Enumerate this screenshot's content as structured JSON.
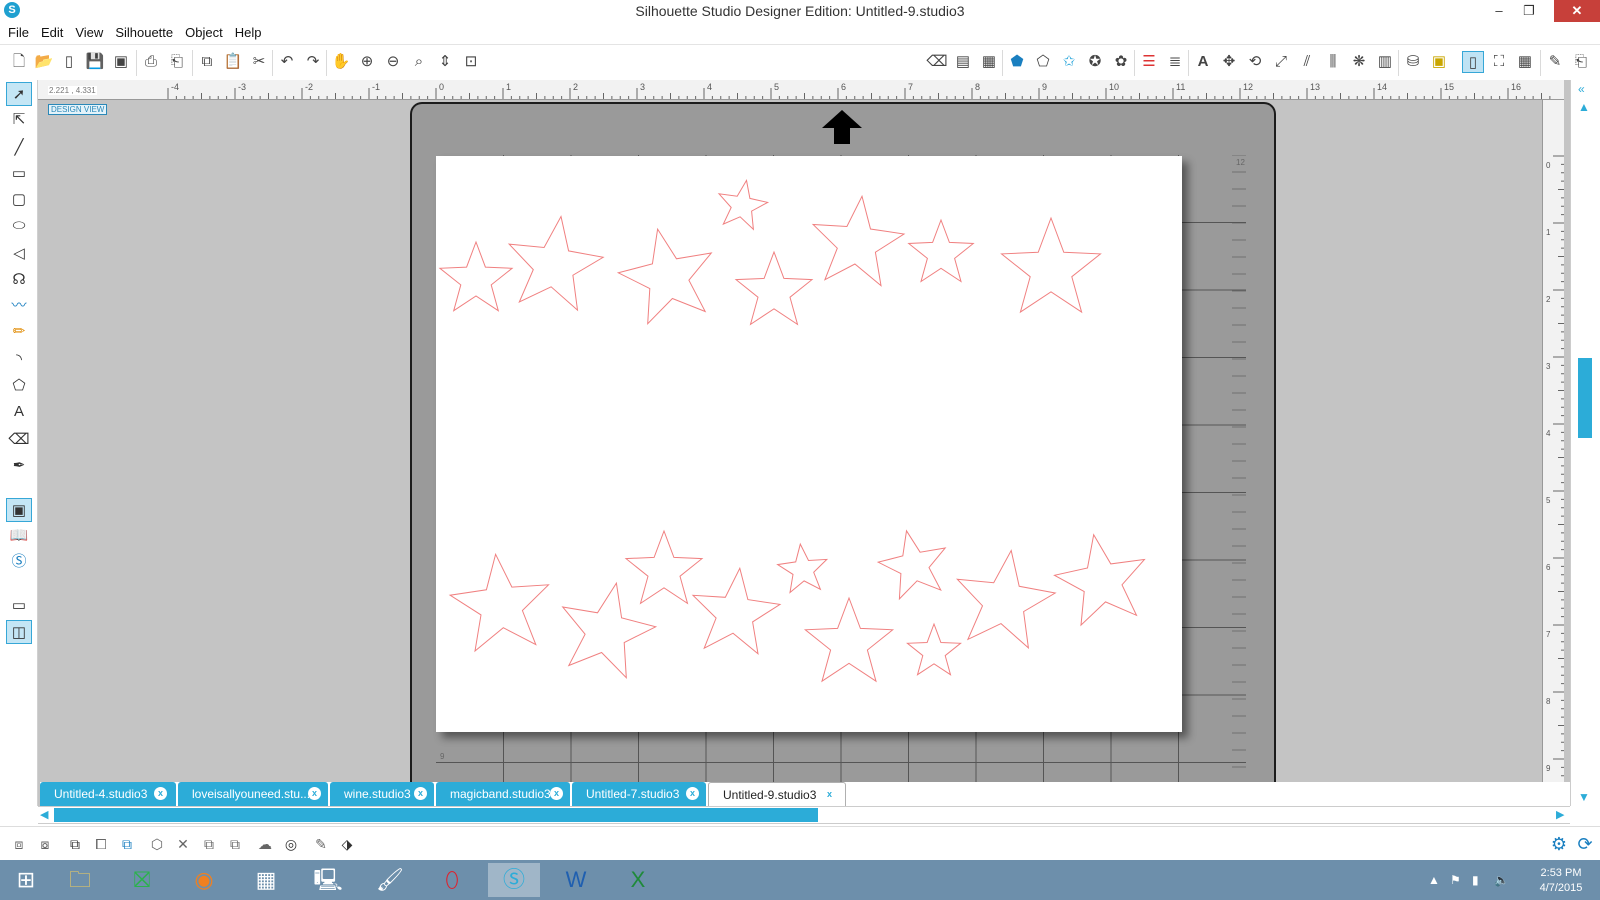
{
  "window": {
    "title": "Silhouette Studio Designer Edition: Untitled-9.studio3",
    "logo": "S",
    "minimize": "–",
    "restore": "❐",
    "close": "✕"
  },
  "menu": [
    "File",
    "Edit",
    "View",
    "Silhouette",
    "Object",
    "Help"
  ],
  "toolbar": {
    "left_icons": [
      "new-document-icon",
      "open-folder-icon",
      "sd-card-icon",
      "save-icon",
      "save-as-icon",
      "print-icon",
      "print-cut-icon",
      "copy-icon",
      "paste-icon",
      "cut-icon",
      "undo-icon",
      "redo-icon",
      "pan-hand-icon",
      "zoom-in-icon",
      "zoom-out-icon",
      "zoom-fit-icon",
      "zoom-drag-icon",
      "fit-page-icon"
    ],
    "right_icons": [
      "eraser-fill-icon",
      "page-setup-icon",
      "grid-icon",
      "fill-color-icon",
      "line-color-icon",
      "line-style-icon",
      "shadow-icon",
      "image-effects-icon",
      "line-style-panel-icon",
      "hatch-icon",
      "text-icon",
      "replicate-icon",
      "rotate-icon",
      "scale-icon",
      "shear-icon",
      "align-icon",
      "offset-icon",
      "trace-icon",
      "library-icon",
      "media-icon",
      "send-to-silhouette-icon",
      "cut-settings-icon",
      "grid-settings-icon",
      "knife-icon",
      "send-icon"
    ]
  },
  "ruler": {
    "top_labels": [
      "-4",
      "-3",
      "-2",
      "-1",
      "0",
      "1",
      "2",
      "3",
      "4",
      "5",
      "6",
      "7",
      "8",
      "9",
      "10",
      "11",
      "12",
      "13",
      "14",
      "15",
      "16"
    ],
    "right_labels": [
      "0",
      "1",
      "2",
      "3",
      "4",
      "5",
      "6",
      "7",
      "8",
      "9"
    ],
    "coords": "2.221 , 4.331",
    "design_view": "DESIGN VIEW"
  },
  "left_tools": [
    "select-tool-icon",
    "edit-points-icon",
    "line-tool-icon",
    "rectangle-tool-icon",
    "rounded-rectangle-icon",
    "ellipse-tool-icon",
    "polygon-tool-icon",
    "curve-tool-icon",
    "freehand-tool-icon",
    "smooth-freehand-icon",
    "arc-tool-icon",
    "regular-polygon-icon",
    "text-tool-icon",
    "eraser-tool-icon",
    "knife-tool-icon",
    "design-page-icon",
    "library-icon",
    "silhouette-store-icon",
    "single-window-icon",
    "split-window-icon"
  ],
  "mat": {
    "corner_top": "12",
    "corner_bottom": "9"
  },
  "tabs": [
    {
      "label": "Untitled-4.studio3",
      "active": false
    },
    {
      "label": "loveisallyouneed.stu...",
      "active": false
    },
    {
      "label": "wine.studio3",
      "active": false
    },
    {
      "label": "magicband.studio3",
      "active": false
    },
    {
      "label": "Untitled-7.studio3",
      "active": false
    },
    {
      "label": "Untitled-9.studio3",
      "active": true
    }
  ],
  "tab_close": "x",
  "stars": {
    "color": "#f08080",
    "items": [
      [
        40,
        124,
        38,
        0
      ],
      [
        118,
        110,
        50,
        8
      ],
      [
        232,
        122,
        50,
        -12
      ],
      [
        306,
        50,
        26,
        10
      ],
      [
        338,
        136,
        40,
        0
      ],
      [
        421,
        88,
        48,
        6
      ],
      [
        505,
        98,
        34,
        0
      ],
      [
        615,
        114,
        52,
        0
      ],
      [
        65,
        450,
        52,
        -6
      ],
      [
        170,
        476,
        50,
        12
      ],
      [
        228,
        415,
        40,
        0
      ],
      [
        299,
        458,
        46,
        6
      ],
      [
        367,
        414,
        26,
        -6
      ],
      [
        413,
        488,
        46,
        0
      ],
      [
        478,
        410,
        36,
        -12
      ],
      [
        498,
        496,
        28,
        0
      ],
      [
        568,
        446,
        52,
        8
      ],
      [
        666,
        426,
        48,
        -10
      ]
    ]
  },
  "bottom_tools": [
    "group-icon",
    "ungroup-icon",
    "compound-path-icon",
    "release-compound-icon",
    "bring-front-icon",
    "weld-icon",
    "subtract-icon",
    "intersect-icon",
    "divide-icon",
    "offset-icon",
    "trace-icon",
    "pencil-icon",
    "align-icon"
  ],
  "taskbar": {
    "apps": [
      "windows-start-icon",
      "file-explorer-icon",
      "store-icon",
      "firefox-icon",
      "resource-monitor-icon",
      "remote-desktop-icon",
      "paint-icon",
      "opera-icon",
      "silhouette-studio-icon",
      "word-icon",
      "excel-icon"
    ],
    "time": "2:53 PM",
    "date": "4/7/2015"
  }
}
